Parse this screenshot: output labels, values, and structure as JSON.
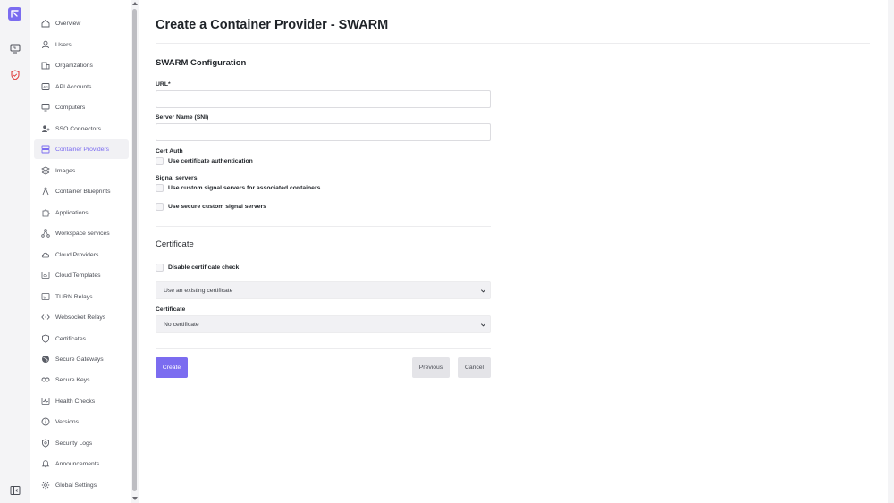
{
  "sidebar": {
    "items": [
      {
        "label": "Overview",
        "icon": "home-icon"
      },
      {
        "label": "Users",
        "icon": "user-icon"
      },
      {
        "label": "Organizations",
        "icon": "organization-icon"
      },
      {
        "label": "API Accounts",
        "icon": "api-icon"
      },
      {
        "label": "Computers",
        "icon": "monitor-icon"
      },
      {
        "label": "SSO Connectors",
        "icon": "user-key-icon"
      },
      {
        "label": "Container Providers",
        "icon": "server-icon",
        "active": true
      },
      {
        "label": "Images",
        "icon": "layers-icon"
      },
      {
        "label": "Container Blueprints",
        "icon": "compass-icon"
      },
      {
        "label": "Applications",
        "icon": "puzzle-icon"
      },
      {
        "label": "Workspace services",
        "icon": "share-icon"
      },
      {
        "label": "Cloud Providers",
        "icon": "cloud-icon"
      },
      {
        "label": "Cloud Templates",
        "icon": "template-icon"
      },
      {
        "label": "TURN Relays",
        "icon": "cast-icon"
      },
      {
        "label": "Websocket Relays",
        "icon": "code-icon"
      },
      {
        "label": "Certificates",
        "icon": "shield-icon"
      },
      {
        "label": "Secure Gateways",
        "icon": "globe-icon"
      },
      {
        "label": "Secure Keys",
        "icon": "key-icon"
      },
      {
        "label": "Health Checks",
        "icon": "activity-icon"
      },
      {
        "label": "Versions",
        "icon": "info-icon"
      },
      {
        "label": "Security Logs",
        "icon": "shield-search-icon"
      },
      {
        "label": "Announcements",
        "icon": "bell-icon"
      },
      {
        "label": "Global Settings",
        "icon": "gear-icon"
      }
    ]
  },
  "page": {
    "title": "Create a Container Provider - SWARM"
  },
  "form": {
    "section_config": "SWARM Configuration",
    "url_label": "URL",
    "url_required_mark": "*",
    "url_value": "",
    "sni_label": "Server Name (SNI)",
    "sni_value": "",
    "cert_auth_label": "Cert Auth",
    "cert_auth_checkbox": "Use certificate authentication",
    "signal_label": "Signal servers",
    "signal_custom_checkbox": "Use custom signal servers for associated containers",
    "signal_secure_checkbox": "Use secure custom signal servers",
    "section_certificate": "Certificate",
    "disable_check_checkbox": "Disable certificate check",
    "cert_mode_select": "Use an existing certificate",
    "certificate_label": "Certificate",
    "certificate_select": "No certificate"
  },
  "buttons": {
    "create": "Create",
    "previous": "Previous",
    "cancel": "Cancel"
  },
  "colors": {
    "accent": "#7b6cf0",
    "rail_active": "#e0403f"
  }
}
